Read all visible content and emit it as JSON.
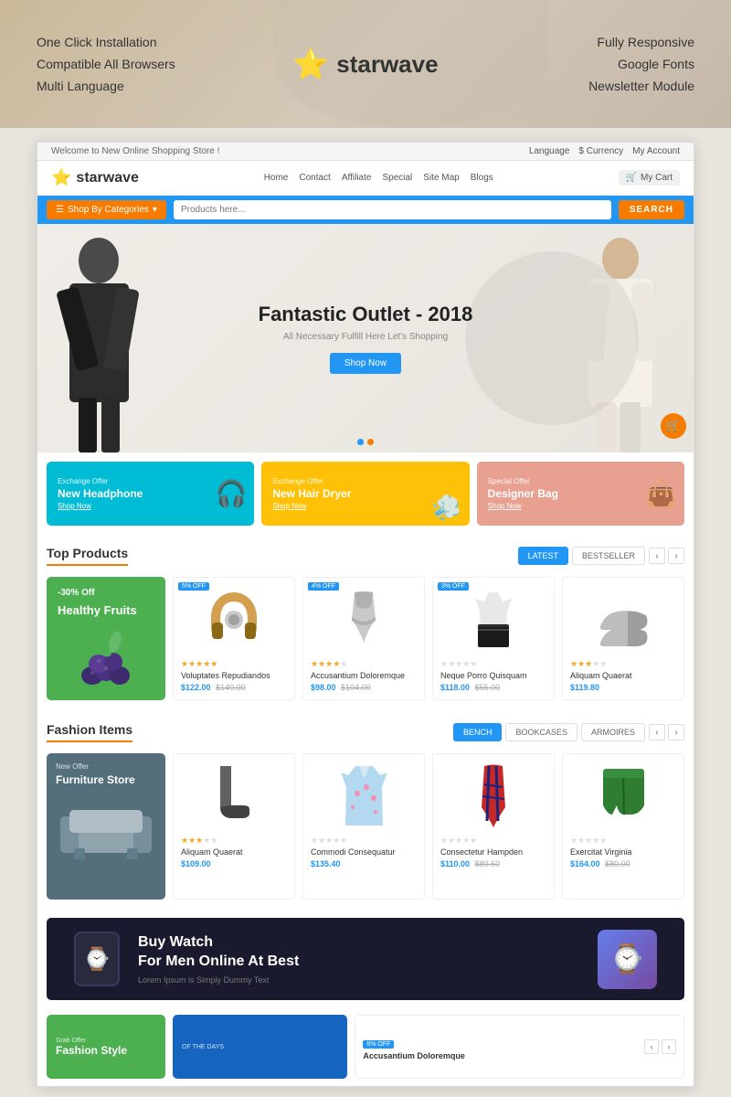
{
  "features": {
    "left": [
      "One Click Installation",
      "Compatible All Browsers",
      "Multi Language"
    ],
    "right": [
      "Fully Responsive",
      "Google Fonts",
      "Newsletter Module"
    ]
  },
  "logo": {
    "text": "starwave",
    "star_icon": "☆"
  },
  "topbar": {
    "welcome": "Welcome to New Online Shopping Store !",
    "language": "Language",
    "currency": "$ Currency",
    "account": "My Account"
  },
  "store_logo": {
    "text": "starwave"
  },
  "nav": {
    "items": [
      "Home",
      "Contact",
      "Affiliate",
      "Special",
      "Site Map",
      "Blogs"
    ],
    "cart": "My Cart"
  },
  "search": {
    "categories_btn": "Shop By Categories",
    "placeholder": "Products here...",
    "search_btn": "SEARCH"
  },
  "hero": {
    "title": "Fantastic Outlet - 2018",
    "subtitle": "All Necessary Fulfill Here Let's Shopping",
    "button": "Shop Now"
  },
  "promo_banners": [
    {
      "label": "Exchange Offer",
      "title": "New Headphone",
      "link": "Shop Now",
      "color": "cyan"
    },
    {
      "label": "Exchange Offer",
      "title": "New Hair Dryer",
      "link": "Shop Now",
      "color": "yellow"
    },
    {
      "label": "Special Offer",
      "title": "Designer Bag",
      "link": "Shop Now",
      "color": "salmon"
    }
  ],
  "top_products": {
    "title": "Top Products",
    "tabs": [
      "LATEST",
      "BESTSELLER"
    ],
    "feature": {
      "discount": "-30% Off",
      "title": "Healthy Fruits"
    },
    "products": [
      {
        "badge": "5% OFF",
        "name": "Voluptates Repudiandos",
        "stars": 5,
        "price": "$122.00",
        "old_price": "$140.00"
      },
      {
        "badge": "4% OFF",
        "name": "Accusantium Doloremque",
        "stars": 4,
        "price": "$98.00",
        "old_price": "$104.00"
      },
      {
        "badge": "3% OFF",
        "name": "Neque Porro Quisquam",
        "stars": 0,
        "price": "$118.00",
        "old_price": "$55.00"
      },
      {
        "badge": "",
        "name": "Aliquam Quaerat",
        "stars": 3.5,
        "price": "$119.80",
        "old_price": ""
      }
    ]
  },
  "fashion_items": {
    "title": "Fashion Items",
    "tabs": [
      "BENCH",
      "BOOKCASES",
      "ARMOIRES"
    ],
    "feature": {
      "label": "New Offer",
      "title": "Furniture Store"
    },
    "products": [
      {
        "name": "Aliquam Quaerat",
        "stars": 3,
        "price": "$109.00",
        "old_price": ""
      },
      {
        "name": "Commodi Consequatur",
        "stars": 0,
        "price": "$135.40",
        "old_price": ""
      },
      {
        "name": "Consectetur Hampden",
        "stars": 0,
        "price": "$110.00",
        "old_price": "$80.60"
      },
      {
        "name": "Exercitat Virginia",
        "stars": 0,
        "price": "$164.00",
        "old_price": "$80.00"
      }
    ]
  },
  "watch_banner": {
    "title": "Buy Watch\nFor Men Online At Best",
    "subtitle": "Lorem Ipsum is Simply Dummy Text"
  },
  "bottom_banners": [
    {
      "label": "Grab Offer",
      "title": "Fashion Style",
      "color": "green"
    },
    {
      "label": "Of The Days",
      "title": "",
      "color": "blue"
    }
  ],
  "bottom_product": {
    "badge": "6% OFF",
    "name": "Accusantium Doloremque"
  }
}
